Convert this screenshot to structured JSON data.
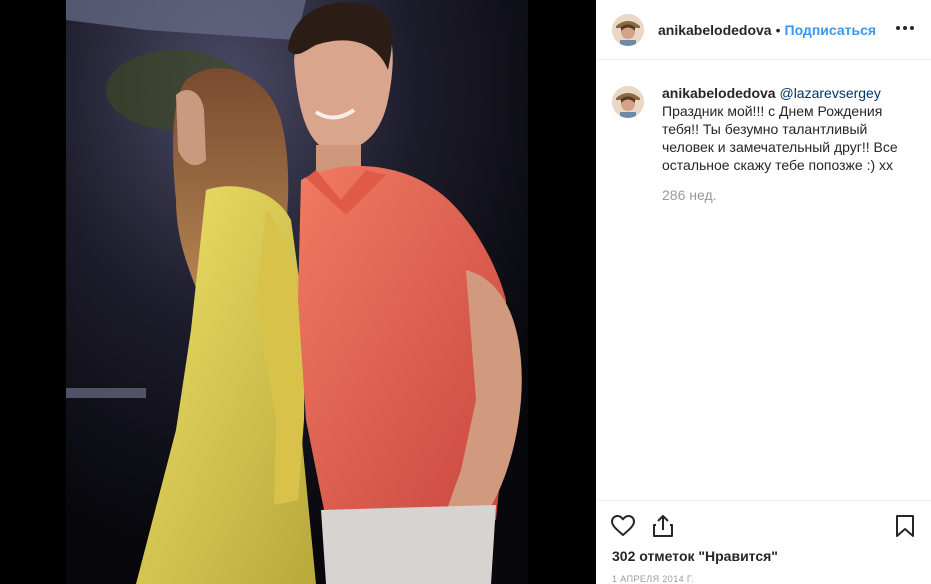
{
  "post": {
    "username": "anikabelodedova",
    "separator": "•",
    "follow_label": "Подписаться",
    "caption": {
      "username": "anikabelodedova",
      "mention": "@lazarevsergey",
      "text": " Праздник мой!!! с Днем Рождения тебя!! Ты безумно талантливый человек и замечательный друг!! Все остальное скажу тебе попозже :) xx",
      "time_ago": "286 нед."
    },
    "likes_text": "302 отметок \"Нравится\"",
    "date": "1 АПРЕЛЯ 2014 Г."
  },
  "icons": {
    "more": "more-options-icon",
    "like": "heart-icon",
    "share": "share-icon",
    "save": "bookmark-icon"
  },
  "colors": {
    "link": "#3897f0",
    "mention": "#003569",
    "muted": "#999999",
    "text": "#262626",
    "shirt": "#e8614f",
    "dress": "#e2d24a"
  }
}
